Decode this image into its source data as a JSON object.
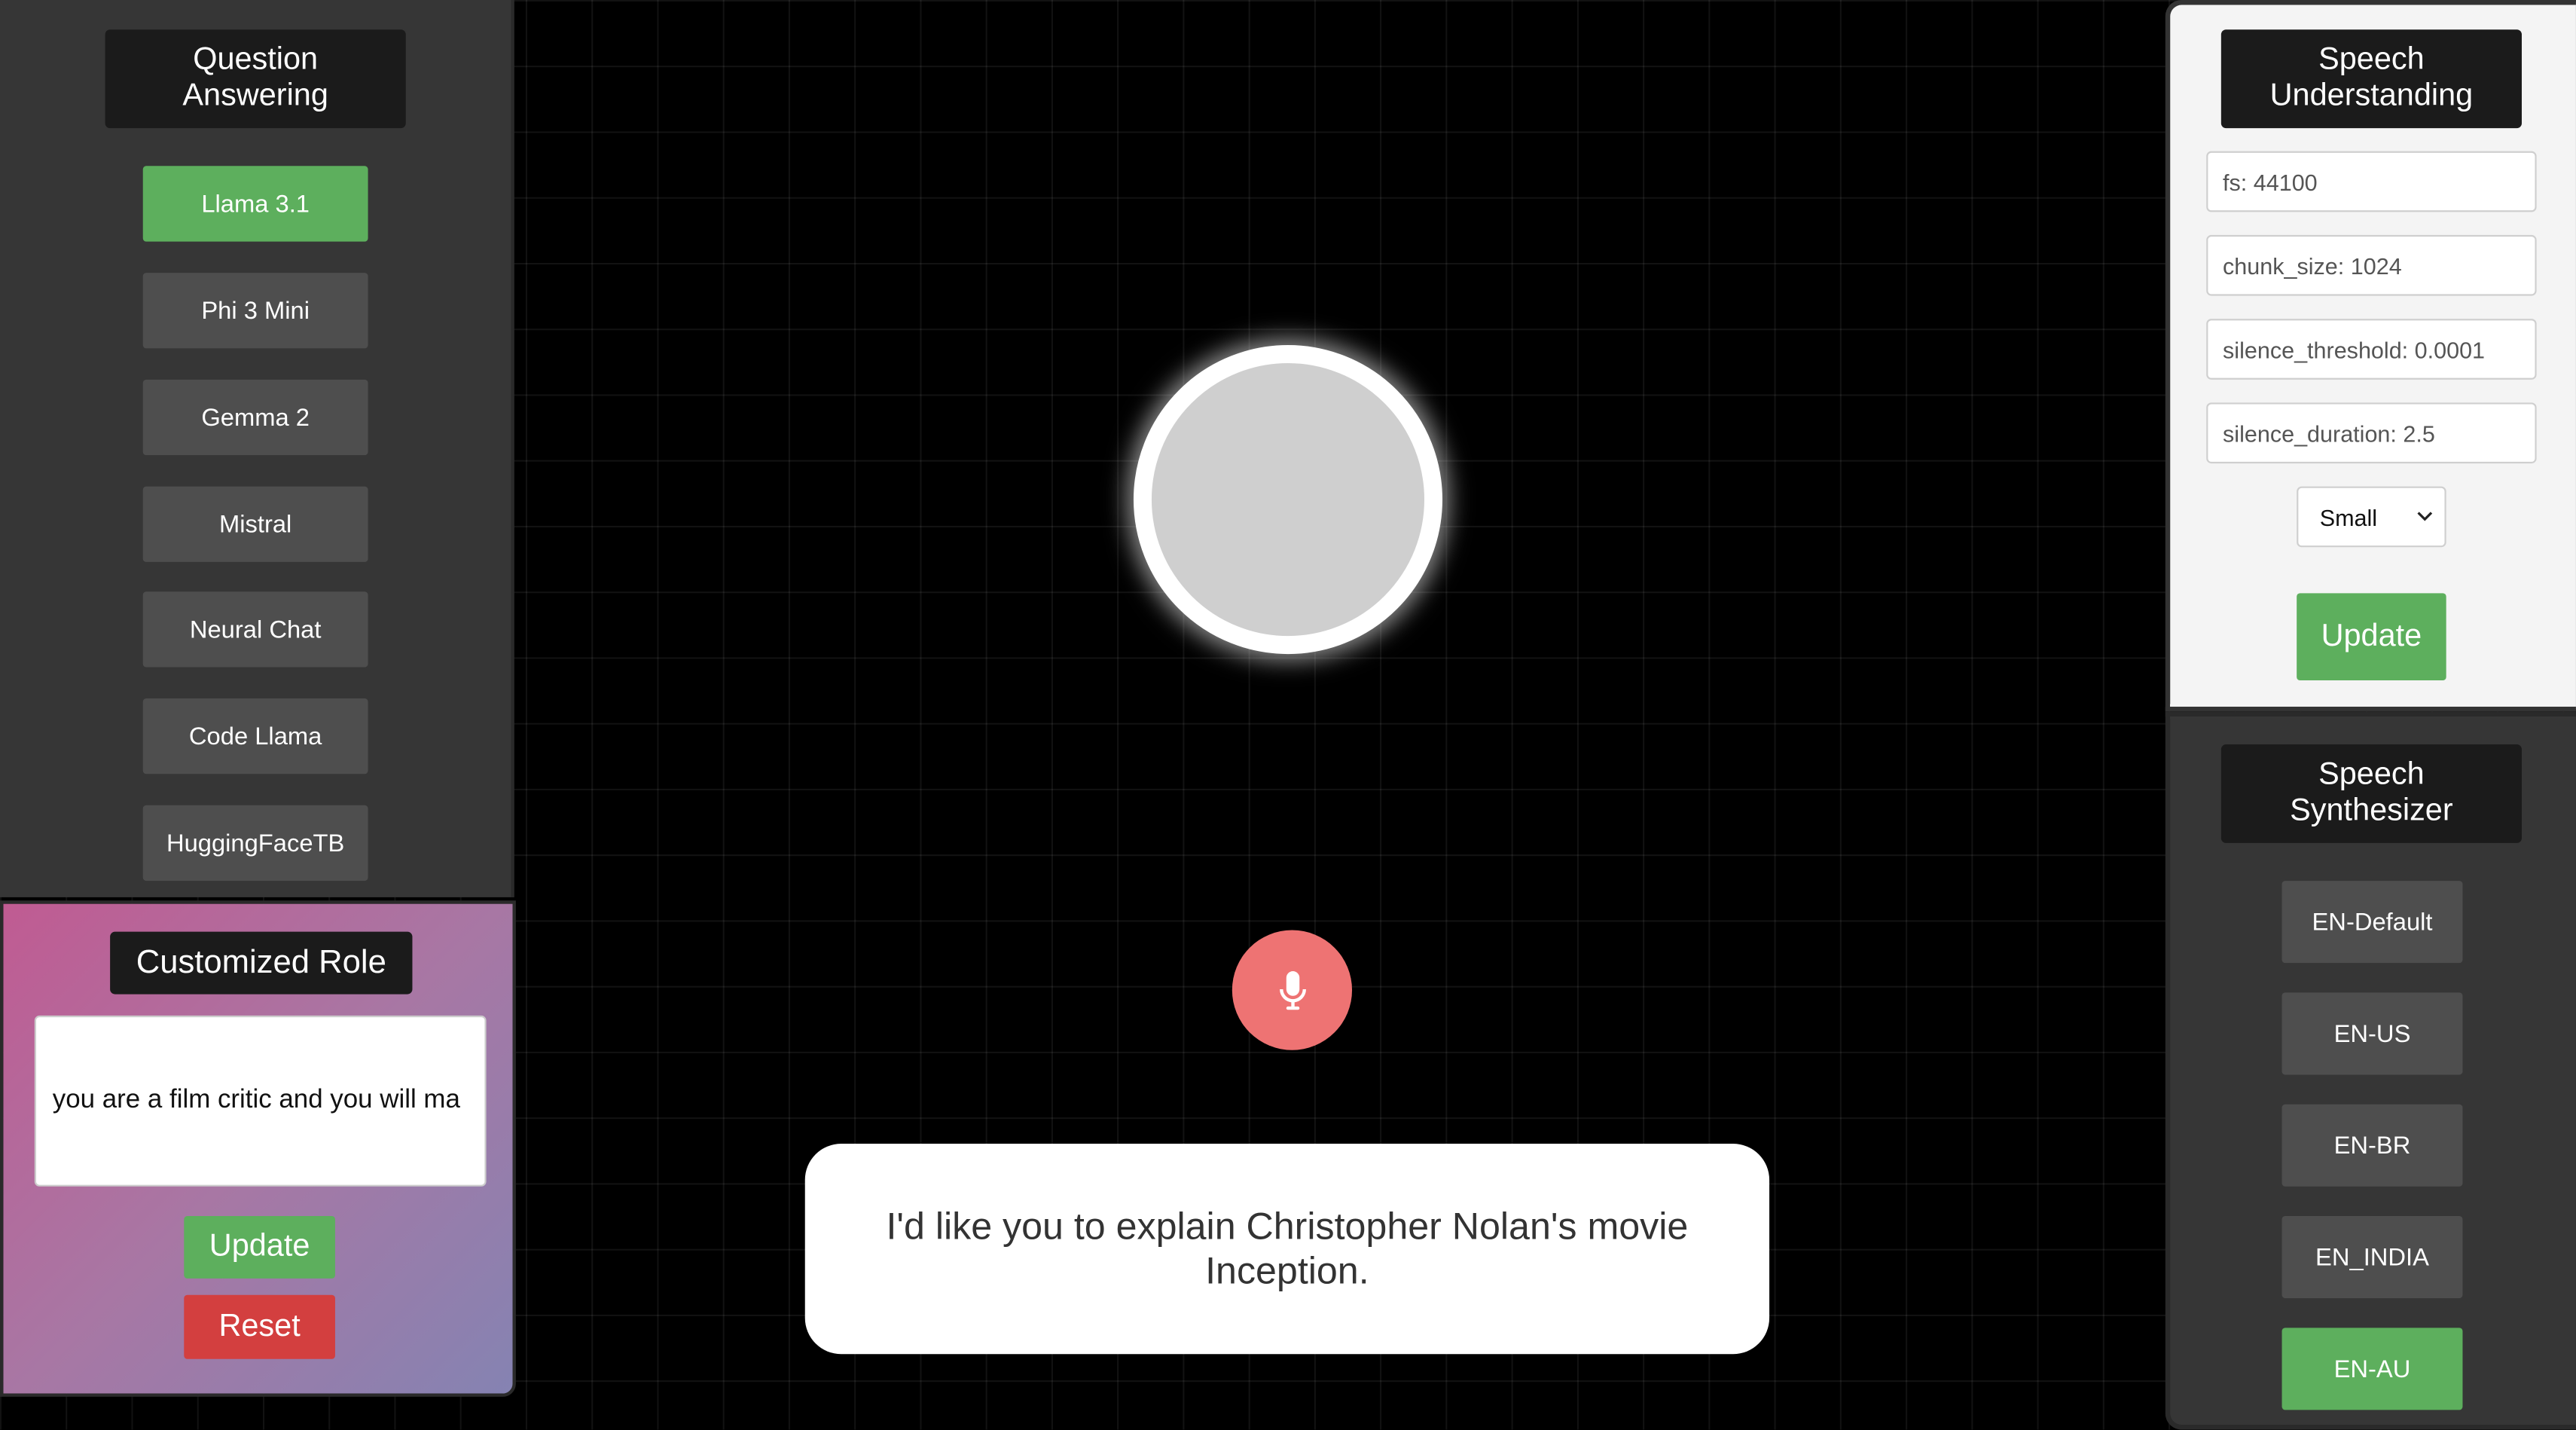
{
  "question_answering": {
    "title": "Question Answering",
    "models": [
      {
        "label": "Llama 3.1",
        "active": true
      },
      {
        "label": "Phi 3 Mini",
        "active": false
      },
      {
        "label": "Gemma 2",
        "active": false
      },
      {
        "label": "Mistral",
        "active": false
      },
      {
        "label": "Neural Chat",
        "active": false
      },
      {
        "label": "Code Llama",
        "active": false
      },
      {
        "label": "HuggingFaceTB",
        "active": false
      }
    ]
  },
  "customized_role": {
    "title": "Customized Role",
    "value": "you are a film critic and you will ma",
    "update_label": "Update",
    "reset_label": "Reset"
  },
  "center": {
    "mic_icon": "microphone-icon",
    "transcript": "I'd like you to explain Christopher Nolan's movie Inception."
  },
  "speech_understanding": {
    "title": "Speech Understanding",
    "fields": {
      "fs": "fs: 44100",
      "chunk_size": "chunk_size: 1024",
      "silence_threshold": "silence_threshold: 0.0001",
      "silence_duration": "silence_duration: 2.5"
    },
    "model_size": "Small",
    "update_label": "Update"
  },
  "speech_synthesizer": {
    "title": "Speech Synthesizer",
    "voices": [
      {
        "label": "EN-Default",
        "active": false
      },
      {
        "label": "EN-US",
        "active": false
      },
      {
        "label": "EN-BR",
        "active": false
      },
      {
        "label": "EN_INDIA",
        "active": false
      },
      {
        "label": "EN-AU",
        "active": true
      }
    ]
  },
  "colors": {
    "active_green": "#5daf5d",
    "reset_red": "#d33f3f",
    "mic_red": "#ee7373",
    "button_gray": "#4e4e4e"
  }
}
